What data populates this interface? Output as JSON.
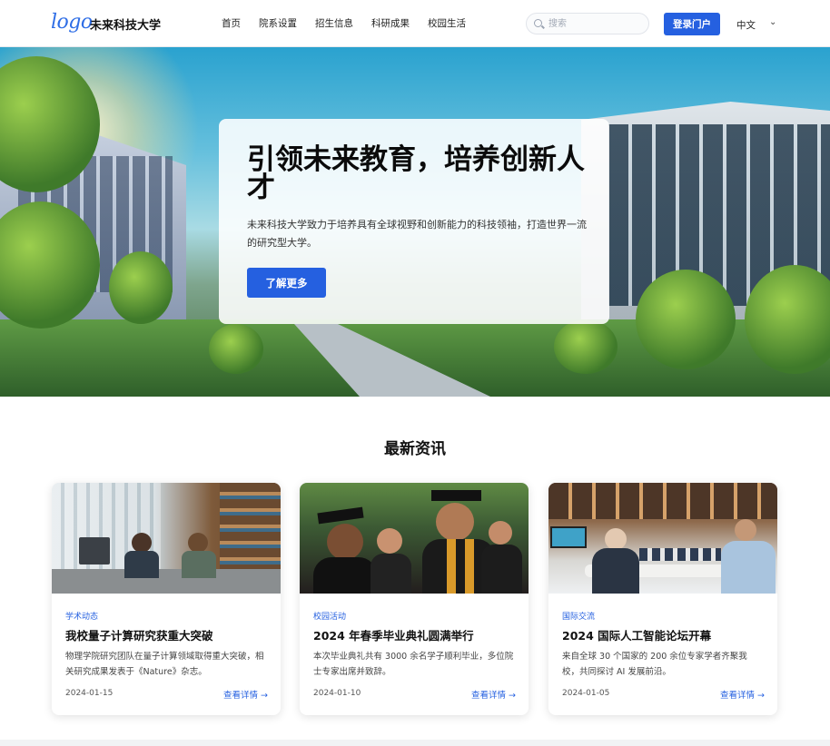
{
  "header": {
    "logo_text": "logo",
    "brand": "未来科技大学",
    "nav": [
      "首页",
      "院系设置",
      "招生信息",
      "科研成果",
      "校园生活"
    ],
    "search_placeholder": "搜索",
    "login_label": "登录门户",
    "language": "中文",
    "language_chevron": "⌄"
  },
  "hero": {
    "title": "引领未来教育，培养创新人才",
    "description": "未来科技大学致力于培养具有全球视野和创新能力的科技领袖，打造世界一流的研究型大学。",
    "cta_label": "了解更多"
  },
  "news": {
    "section_title": "最新资讯",
    "more_label": "查看详情 →",
    "items": [
      {
        "category": "学术动态",
        "title": "我校量子计算研究获重大突破",
        "description": "物理学院研究团队在量子计算领域取得重大突破，相关研究成果发表于《Nature》杂志。",
        "date": "2024-01-15",
        "image_icon": "lab-photo"
      },
      {
        "category": "校园活动",
        "title": "2024 年春季毕业典礼圆满举行",
        "description": "本次毕业典礼共有 3000 余名学子顺利毕业，多位院士专家出席并致辞。",
        "date": "2024-01-10",
        "image_icon": "graduation-photo"
      },
      {
        "category": "国际交流",
        "title": "2024 国际人工智能论坛开幕",
        "description": "来自全球 30 个国家的 200 余位专家学者齐聚我校，共同探讨 AI 发展前沿。",
        "date": "2024-01-05",
        "image_icon": "forum-photo"
      }
    ]
  },
  "colors": {
    "primary": "#2560e0",
    "text": "#111111"
  }
}
